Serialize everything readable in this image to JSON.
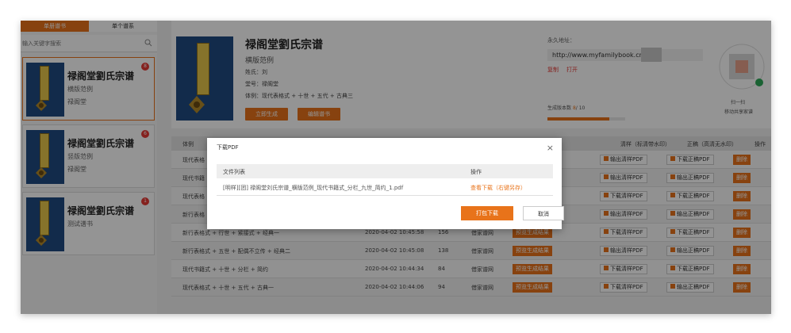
{
  "sidebar": {
    "tabs": [
      "单册谱书",
      "单个谱系"
    ],
    "search_placeholder": "输入关键字搜索",
    "books": [
      {
        "title": "禄阁堂劉氏宗谱",
        "layout": "横版范例",
        "hall": "禄阁堂",
        "count": "8"
      },
      {
        "title": "禄阁堂劉氏宗谱",
        "layout": "竖版范例",
        "hall": "禄阁堂",
        "count": "6"
      },
      {
        "title": "禄阁堂劉氏宗谱",
        "layout": "测试谱书",
        "hall": "",
        "count": "1"
      }
    ]
  },
  "book": {
    "title": "禄阁堂劉氏宗谱",
    "subtitle": "横版范例",
    "surname": "姓氏：刘",
    "hall": "堂号：禄阁堂",
    "style": "体例：现代表格式 + 十世 + 五代 + 古典三",
    "generate_label": "立即生成",
    "edit_label": "编辑谱书"
  },
  "share": {
    "link_label": "永久地址：",
    "link_url": "http://www.myfamilybook.cn/s",
    "copy_label": "复制",
    "open_label": "打开",
    "progress_label": "生成版本数",
    "progress_used": "8",
    "progress_total": "/ 10",
    "progress_fraction": 0.8,
    "qr_caption": "扫一扫",
    "qr_sub": "移动共享家谱"
  },
  "table": {
    "headers": [
      "体例",
      "清样（标清带水印）",
      "正稿（高清无水印）",
      "操作"
    ],
    "rows": [
      {
        "style": "现代表格",
        "date": "",
        "size": "",
        "status": "",
        "preview": "",
        "draft": "输出清样PDF",
        "final": "下载正稿PDF",
        "action": "删除"
      },
      {
        "style": "现代书籍",
        "date": "",
        "size": "",
        "status": "",
        "preview": "",
        "draft": "输出清样PDF",
        "final": "输出正稿PDF",
        "action": "删除"
      },
      {
        "style": "现代表格",
        "date": "",
        "size": "",
        "status": "",
        "preview": "",
        "draft": "下载清样PDF",
        "final": "下载正稿PDF",
        "action": "删除"
      },
      {
        "style": "新行表格",
        "date": "",
        "size": "",
        "status": "",
        "preview": "",
        "draft": "输出清样PDF",
        "final": "输出正稿PDF",
        "action": "删除"
      },
      {
        "style": "新行表格式 + 行世 + 紧接式 + 经典一",
        "date": "2020-04-02 10:45:58",
        "size": "156",
        "status": "借家谱网",
        "preview": "预览生成结果",
        "draft": "下载清样PDF",
        "final": "下载正稿PDF",
        "action": "删除"
      },
      {
        "style": "新行表格式 + 五世 + 配偶不立传 + 经典二",
        "date": "2020-04-02 10:45:08",
        "size": "138",
        "status": "借家谱网",
        "preview": "预览生成结果",
        "draft": "输出清样PDF",
        "final": "输出正稿PDF",
        "action": "删除"
      },
      {
        "style": "现代书籍式 + 十世 + 分栏 + 简约",
        "date": "2020-04-02 10:44:34",
        "size": "84",
        "status": "借家谱网",
        "preview": "预览生成结果",
        "draft": "下载清样PDF",
        "final": "下载正稿PDF",
        "action": "删除"
      },
      {
        "style": "现代表格式 + 十世 + 五代 + 古典一",
        "date": "2020-04-02 10:44:06",
        "size": "94",
        "status": "借家谱网",
        "preview": "预览生成结果",
        "draft": "下载清样PDF",
        "final": "输出正稿PDF",
        "action": "删除"
      }
    ]
  },
  "modal": {
    "title": "下载PDF",
    "col_file": "文件列表",
    "col_action": "操作",
    "file_name": "[明样][团] 禄阁堂刘氏宗谱_横版范例_现代书籍式_分栏_九世_简约_1.pdf",
    "file_action": "查看下载（右键另存）",
    "download_label": "打包下载",
    "cancel_label": "取消"
  },
  "colors": {
    "accent": "#e8731a",
    "badge": "#e53935"
  }
}
